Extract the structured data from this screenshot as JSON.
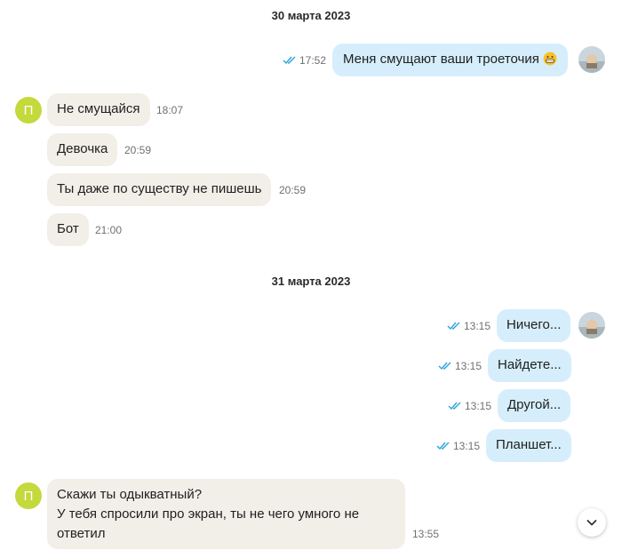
{
  "dates": [
    "30 марта 2023",
    "31 марта 2023"
  ],
  "contact": {
    "avatar_letter": "П"
  },
  "messages": [
    {
      "text": "Меня смущают ваши троеточия",
      "time": "17:52",
      "emoji": "grinning-face-icon"
    },
    {
      "text": "Не смущайся",
      "time": "18:07"
    },
    {
      "text": "Девочка",
      "time": "20:59"
    },
    {
      "text": "Ты даже по существу не пишешь",
      "time": "20:59"
    },
    {
      "text": "Бот",
      "time": "21:00"
    },
    {
      "text": "Ничего...",
      "time": "13:15"
    },
    {
      "text": "Найдете...",
      "time": "13:15"
    },
    {
      "text": "Другой...",
      "time": "13:15"
    },
    {
      "text": "Планшет...",
      "time": "13:15"
    },
    {
      "lines": [
        "Скажи ты одыкватный?",
        "У тебя спросили про экран, ты не чего умного не",
        "ответил"
      ],
      "time": "13:55"
    }
  ],
  "colors": {
    "incoming": "#f2efe8",
    "outgoing": "#d6eefc",
    "avatar": "#c4d93b",
    "ticks": "#2ba3e0"
  },
  "icons": {
    "read": "double-check-icon",
    "scroll": "chevron-down-icon"
  }
}
